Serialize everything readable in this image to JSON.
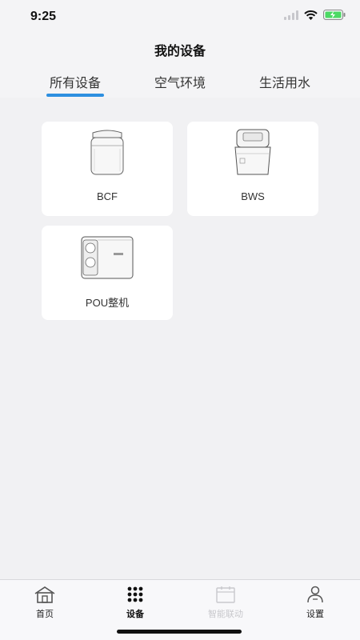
{
  "status_bar": {
    "time": "9:25",
    "icons": [
      "signal-icon",
      "wifi-icon",
      "battery-charging-icon"
    ]
  },
  "header": {
    "title": "我的设备"
  },
  "tabs": [
    {
      "label": "所有设备",
      "active": true
    },
    {
      "label": "空气环境",
      "active": false
    },
    {
      "label": "生活用水",
      "active": false
    }
  ],
  "accent_color": "#2d8fe0",
  "devices": [
    {
      "label": "BCF",
      "icon": "air-purifier-icon"
    },
    {
      "label": "BWS",
      "icon": "water-softener-icon"
    },
    {
      "label": "POU整机",
      "icon": "water-purifier-icon"
    }
  ],
  "tabbar": {
    "items": [
      {
        "label": "首页",
        "icon": "home-icon",
        "active": false,
        "enabled": true
      },
      {
        "label": "设备",
        "icon": "grid-dots-icon",
        "active": true,
        "enabled": true
      },
      {
        "label": "智能联动",
        "icon": "calendar-icon",
        "active": false,
        "enabled": false
      },
      {
        "label": "设置",
        "icon": "user-settings-icon",
        "active": false,
        "enabled": true
      }
    ]
  }
}
